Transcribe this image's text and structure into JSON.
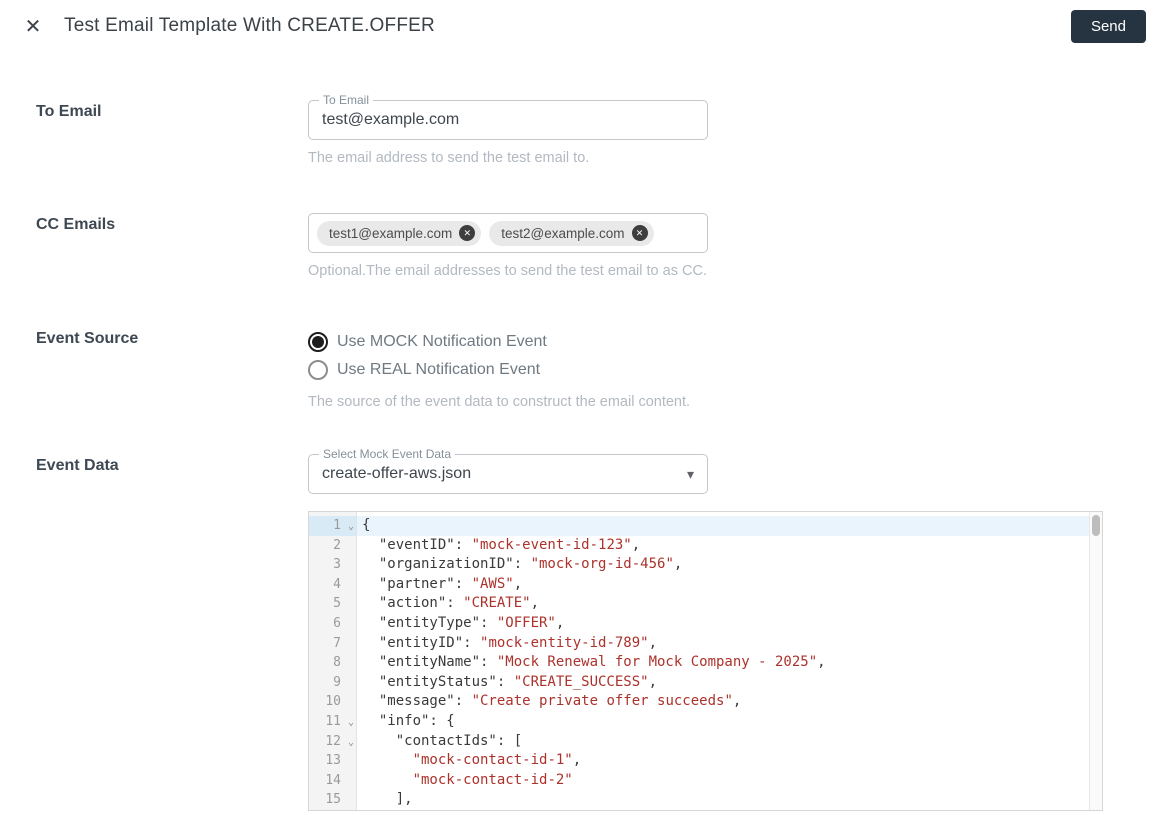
{
  "header": {
    "title": "Test Email Template With CREATE.OFFER",
    "send_label": "Send"
  },
  "icons": {
    "close": "✕",
    "chip_remove": "✕",
    "dropdown_arrow": "▾",
    "fold": "⌄"
  },
  "colors": {
    "send_button_bg": "#263341",
    "code_string": "#ac322c",
    "active_line_bg": "#eaf4fd",
    "helper_text": "#b2b9c0"
  },
  "to_email": {
    "label": "To Email",
    "field_label": "To Email",
    "value": "test@example.com",
    "helper": "The email address to send the test email to."
  },
  "cc_emails": {
    "label": "CC Emails",
    "chips": [
      {
        "label": "test1@example.com"
      },
      {
        "label": "test2@example.com"
      }
    ],
    "helper": "Optional.The email addresses to send the test email to as CC."
  },
  "event_source": {
    "label": "Event Source",
    "options": [
      {
        "label": "Use MOCK Notification Event",
        "selected": true
      },
      {
        "label": "Use REAL Notification Event",
        "selected": false
      }
    ],
    "helper": "The source of the event data to construct the email content."
  },
  "event_data": {
    "label": "Event Data",
    "select_label": "Select Mock Event Data",
    "selected_value": "create-offer-aws.json"
  },
  "editor": {
    "lines": [
      {
        "num": "1",
        "fold": true,
        "active": true,
        "tokens": [
          {
            "t": "{"
          }
        ]
      },
      {
        "num": "2",
        "tokens": [
          {
            "t": "  \"eventID\": "
          },
          {
            "t": "\"mock-event-id-123\"",
            "s": 1
          },
          {
            "t": ","
          }
        ]
      },
      {
        "num": "3",
        "tokens": [
          {
            "t": "  \"organizationID\": "
          },
          {
            "t": "\"mock-org-id-456\"",
            "s": 1
          },
          {
            "t": ","
          }
        ]
      },
      {
        "num": "4",
        "tokens": [
          {
            "t": "  \"partner\": "
          },
          {
            "t": "\"AWS\"",
            "s": 1
          },
          {
            "t": ","
          }
        ]
      },
      {
        "num": "5",
        "tokens": [
          {
            "t": "  \"action\": "
          },
          {
            "t": "\"CREATE\"",
            "s": 1
          },
          {
            "t": ","
          }
        ]
      },
      {
        "num": "6",
        "tokens": [
          {
            "t": "  \"entityType\": "
          },
          {
            "t": "\"OFFER\"",
            "s": 1
          },
          {
            "t": ","
          }
        ]
      },
      {
        "num": "7",
        "tokens": [
          {
            "t": "  \"entityID\": "
          },
          {
            "t": "\"mock-entity-id-789\"",
            "s": 1
          },
          {
            "t": ","
          }
        ]
      },
      {
        "num": "8",
        "tokens": [
          {
            "t": "  \"entityName\": "
          },
          {
            "t": "\"Mock Renewal for Mock Company - 2025\"",
            "s": 1
          },
          {
            "t": ","
          }
        ]
      },
      {
        "num": "9",
        "tokens": [
          {
            "t": "  \"entityStatus\": "
          },
          {
            "t": "\"CREATE_SUCCESS\"",
            "s": 1
          },
          {
            "t": ","
          }
        ]
      },
      {
        "num": "10",
        "tokens": [
          {
            "t": "  \"message\": "
          },
          {
            "t": "\"Create private offer succeeds\"",
            "s": 1
          },
          {
            "t": ","
          }
        ]
      },
      {
        "num": "11",
        "fold": true,
        "tokens": [
          {
            "t": "  \"info\": {"
          }
        ]
      },
      {
        "num": "12",
        "fold": true,
        "tokens": [
          {
            "t": "    \"contactIds\": ["
          }
        ]
      },
      {
        "num": "13",
        "tokens": [
          {
            "t": "      "
          },
          {
            "t": "\"mock-contact-id-1\"",
            "s": 1
          },
          {
            "t": ","
          }
        ]
      },
      {
        "num": "14",
        "tokens": [
          {
            "t": "      "
          },
          {
            "t": "\"mock-contact-id-2\"",
            "s": 1
          }
        ]
      },
      {
        "num": "15",
        "tokens": [
          {
            "t": "    ],"
          }
        ]
      }
    ]
  }
}
